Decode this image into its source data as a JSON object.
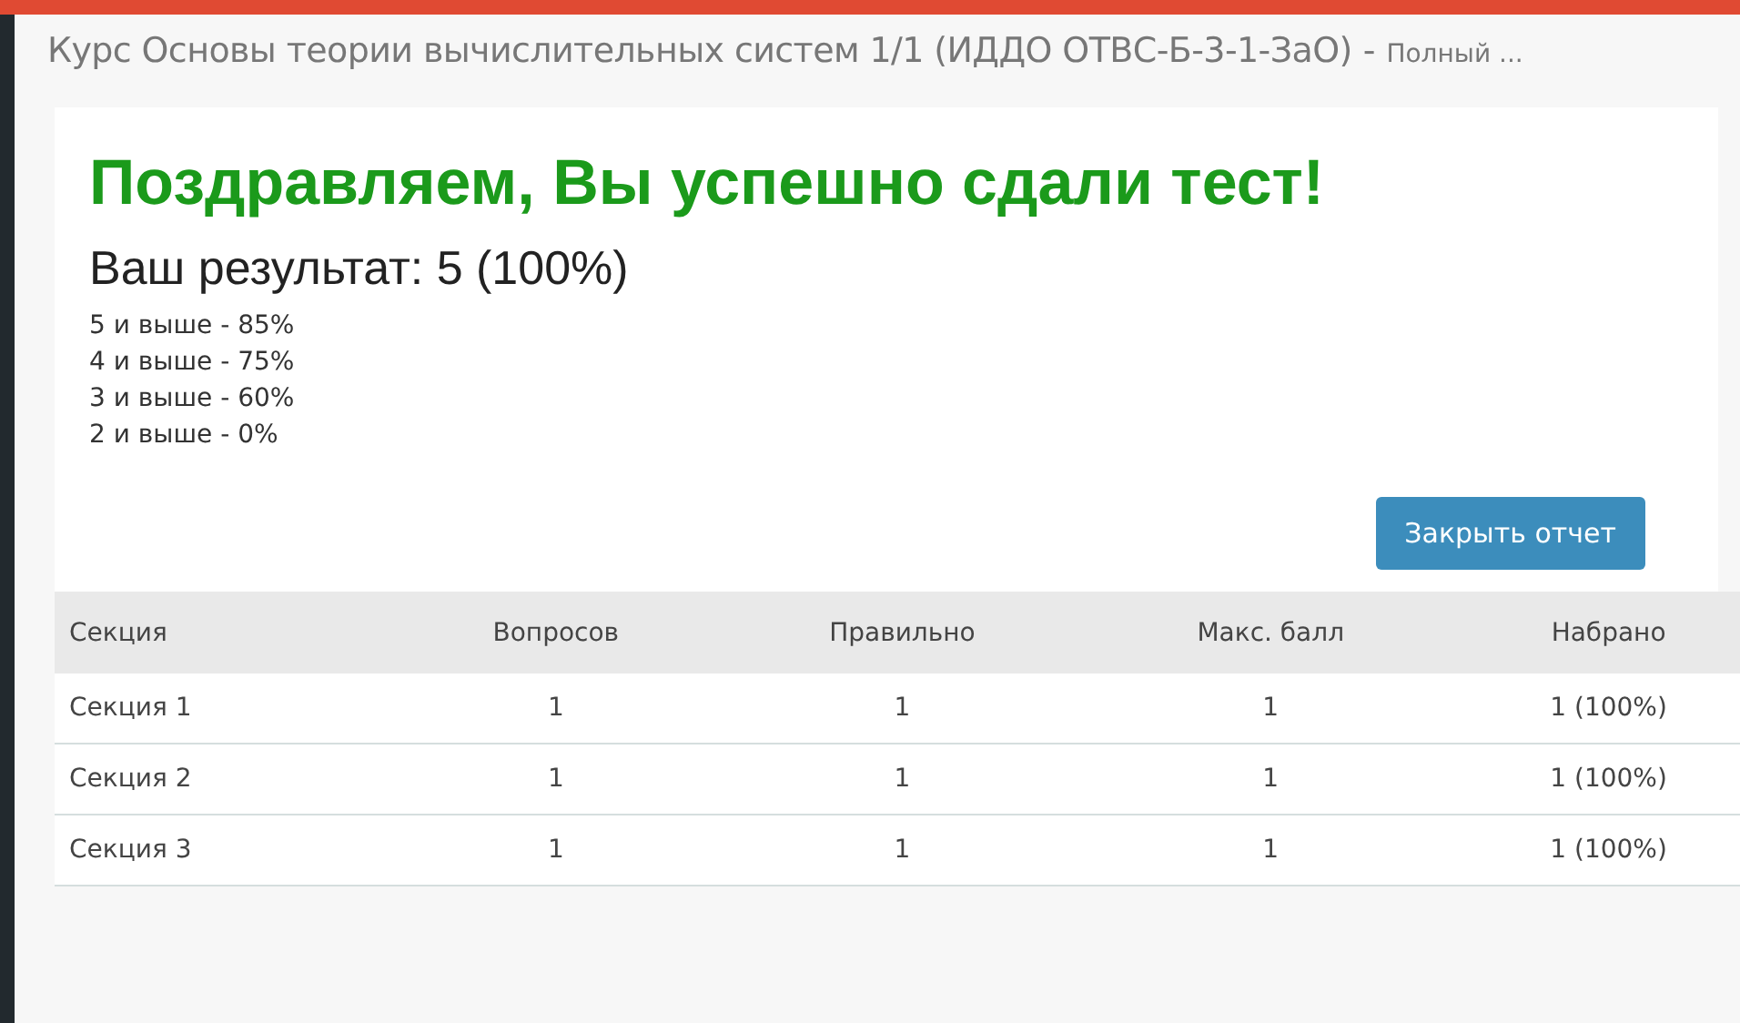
{
  "page_title": {
    "course": "Курс Основы теории вычислительных систем 1/1 (ИДДО ОТВС-Б-3-1-ЗаО)",
    "separator": "-",
    "suffix": "Полный ..."
  },
  "result": {
    "heading": "Поздравляем, Вы успешно сдали тест!",
    "score": "Ваш результат: 5 (100%)",
    "grades": [
      "5 и выше - 85%",
      "4 и выше - 75%",
      "3 и выше - 60%",
      "2 и выше - 0%"
    ],
    "close_button": "Закрыть отчет"
  },
  "table": {
    "columns": [
      "Секция",
      "Вопросов",
      "Правильно",
      "Макс. балл",
      "Набрано"
    ],
    "rows": [
      [
        "Секция 1",
        "1",
        "1",
        "1",
        "1 (100%)"
      ],
      [
        "Секция 2",
        "1",
        "1",
        "1",
        "1 (100%)"
      ],
      [
        "Секция 3",
        "1",
        "1",
        "1",
        "1 (100%)"
      ]
    ]
  }
}
